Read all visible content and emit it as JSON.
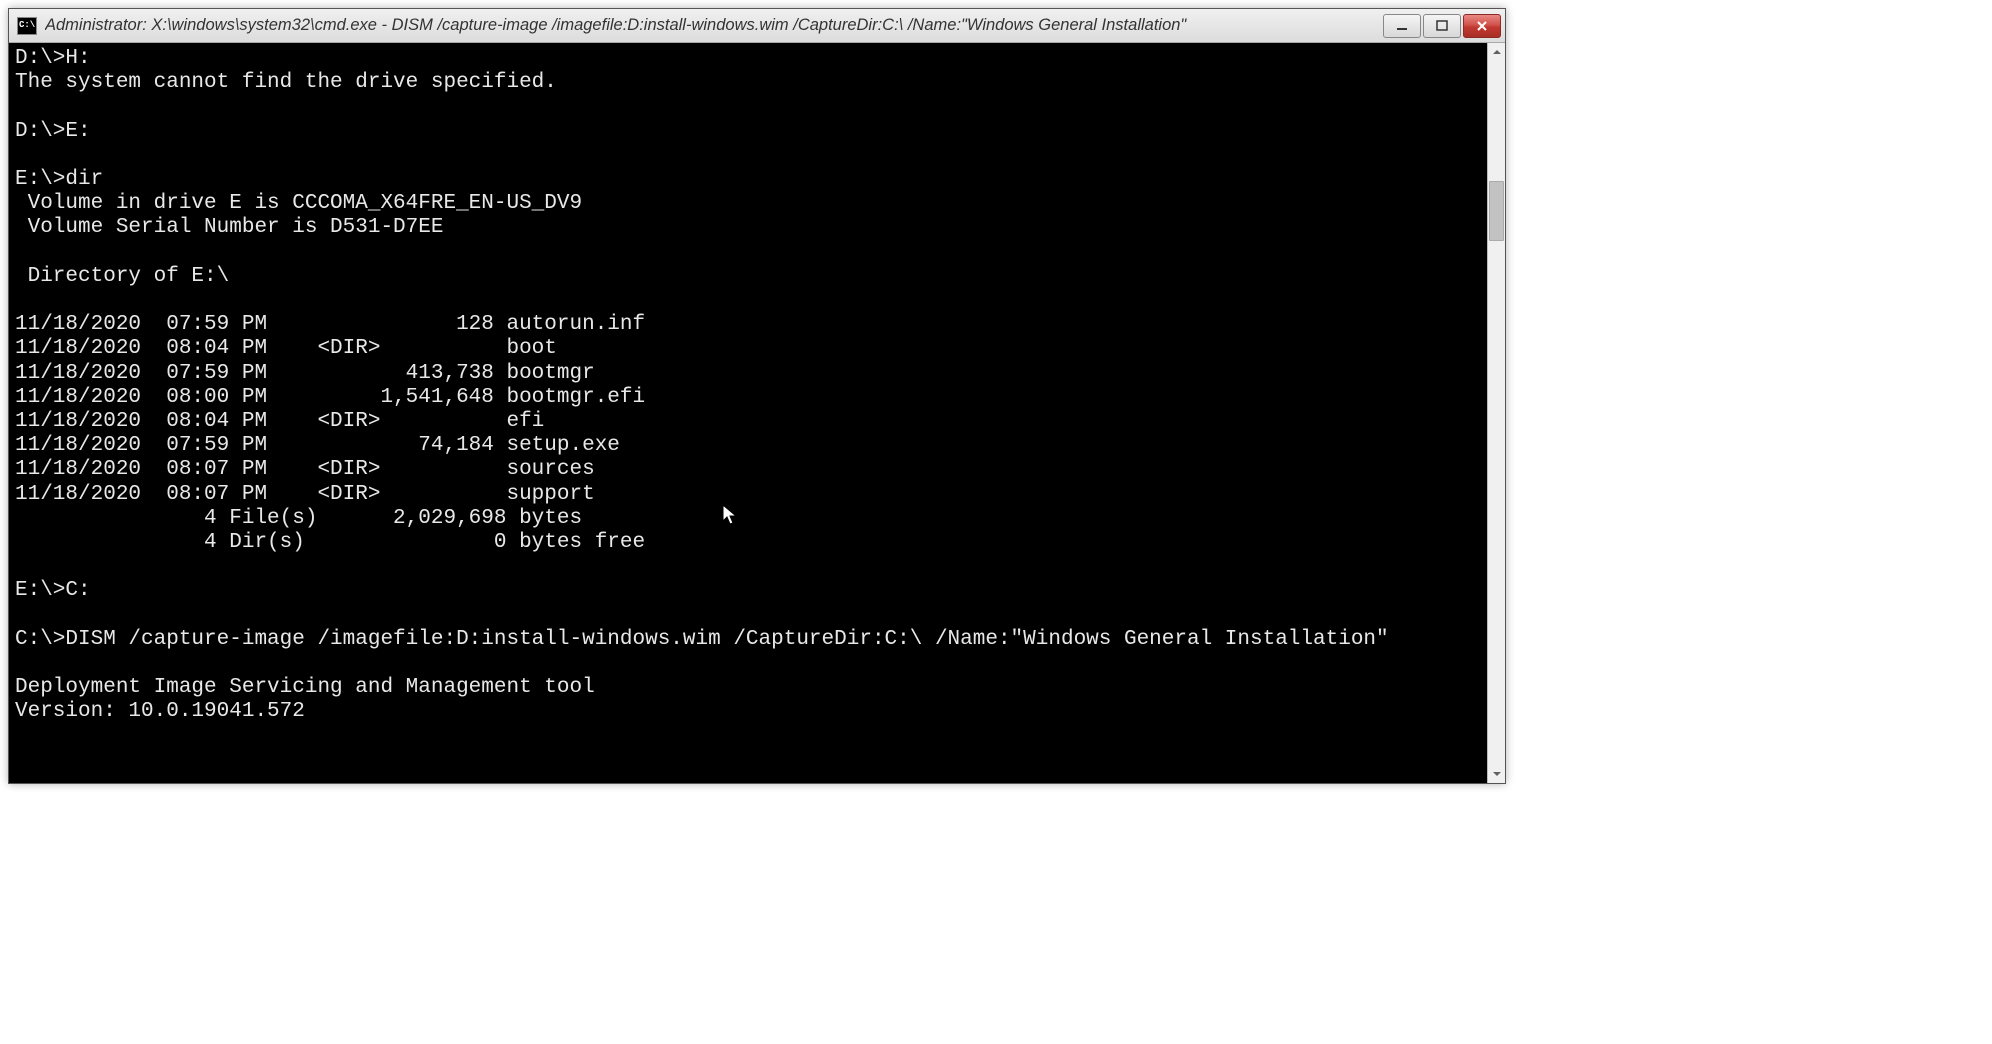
{
  "window": {
    "title": "Administrator: X:\\windows\\system32\\cmd.exe - DISM  /capture-image /imagefile:D:install-windows.wim /CaptureDir:C:\\ /Name:\"Windows General Installation\"",
    "icon_label": "C:\\"
  },
  "terminal": {
    "lines": [
      "D:\\>H:",
      "The system cannot find the drive specified.",
      "",
      "D:\\>E:",
      "",
      "E:\\>dir",
      " Volume in drive E is CCCOMA_X64FRE_EN-US_DV9",
      " Volume Serial Number is D531-D7EE",
      "",
      " Directory of E:\\",
      "",
      "11/18/2020  07:59 PM               128 autorun.inf",
      "11/18/2020  08:04 PM    <DIR>          boot",
      "11/18/2020  07:59 PM           413,738 bootmgr",
      "11/18/2020  08:00 PM         1,541,648 bootmgr.efi",
      "11/18/2020  08:04 PM    <DIR>          efi",
      "11/18/2020  07:59 PM            74,184 setup.exe",
      "11/18/2020  08:07 PM    <DIR>          sources",
      "11/18/2020  08:07 PM    <DIR>          support",
      "               4 File(s)      2,029,698 bytes",
      "               4 Dir(s)               0 bytes free",
      "",
      "E:\\>C:",
      "",
      "C:\\>DISM /capture-image /imagefile:D:install-windows.wim /CaptureDir:C:\\ /Name:\"Windows General Installation\"",
      "",
      "Deployment Image Servicing and Management tool",
      "Version: 10.0.19041.572",
      ""
    ]
  }
}
